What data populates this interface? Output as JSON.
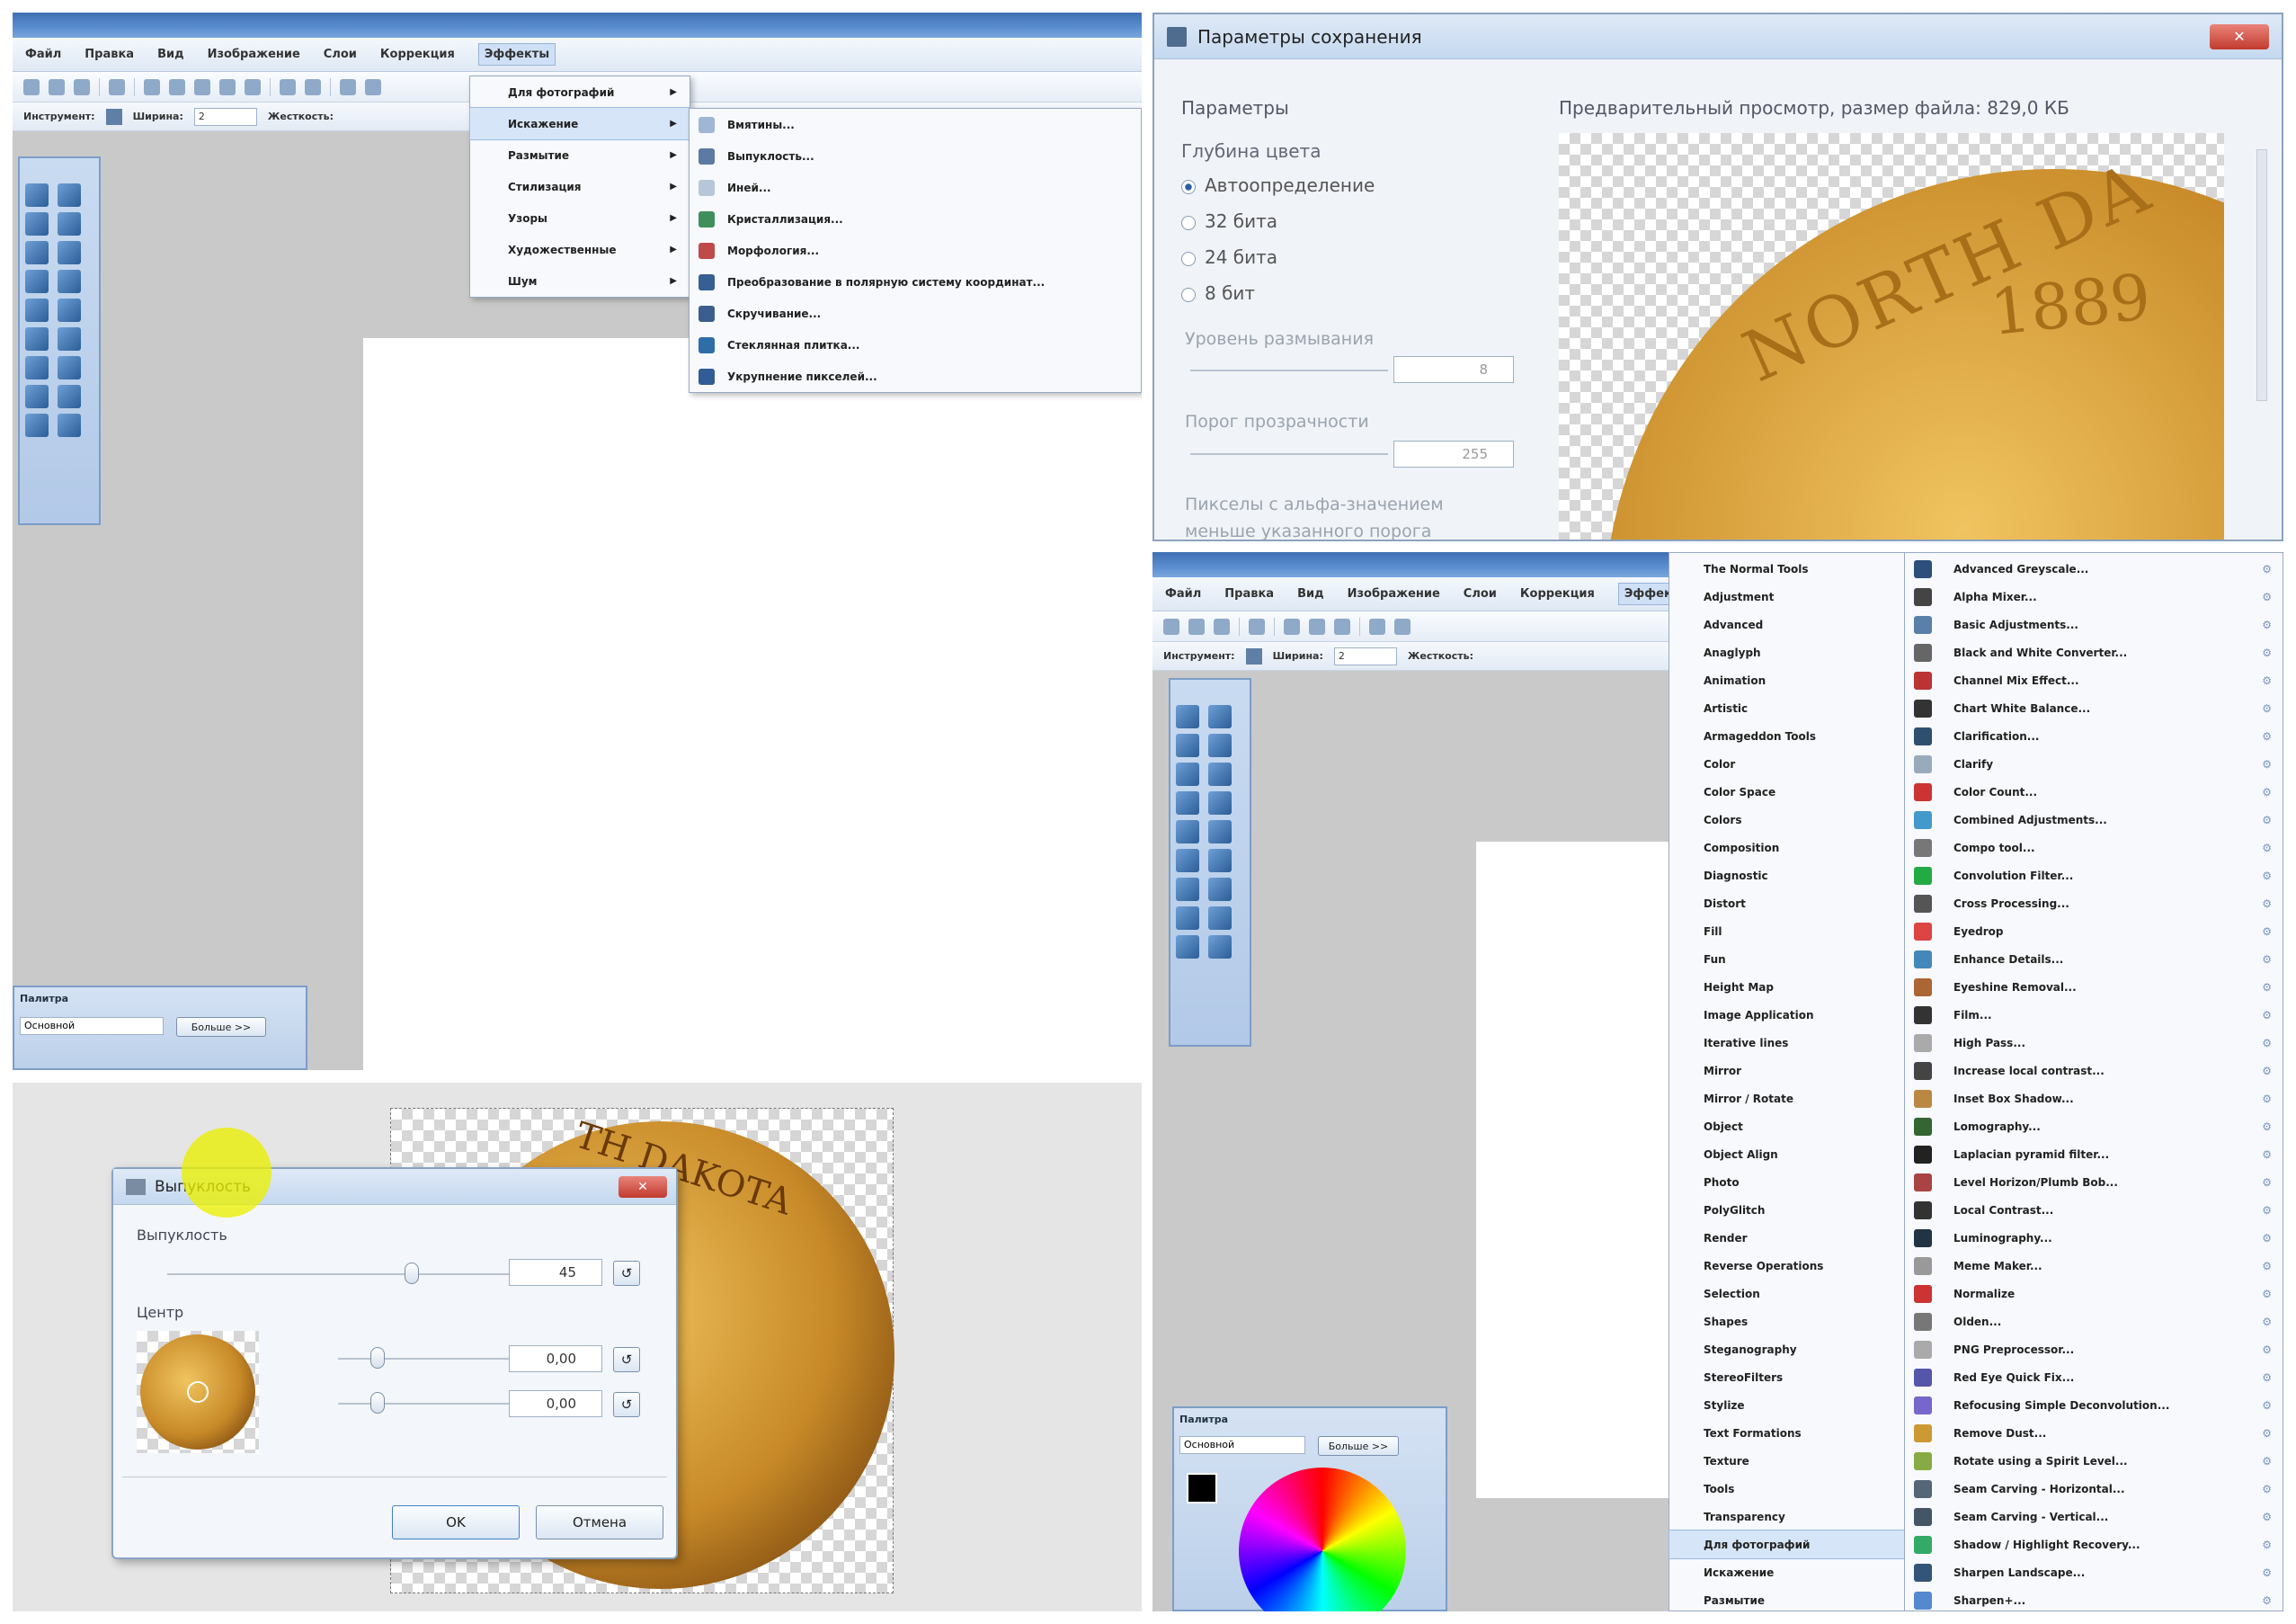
{
  "pdn_menu_panel": {
    "menubar": [
      "Файл",
      "Правка",
      "Вид",
      "Изображение",
      "Слои",
      "Коррекция",
      "Эффекты"
    ],
    "active_menu": "Эффекты",
    "tool_label": "Инструмент:",
    "width_label": "Ширина:",
    "width_value": "2",
    "hardness_label": "Жесткость:",
    "effects_menu": [
      {
        "label": "Для фотографий",
        "highlight": false
      },
      {
        "label": "Искажение",
        "highlight": true
      },
      {
        "label": "Размытие",
        "highlight": false
      },
      {
        "label": "Стилизация",
        "highlight": false
      },
      {
        "label": "Узоры",
        "highlight": false
      },
      {
        "label": "Художественные",
        "highlight": false
      },
      {
        "label": "Шум",
        "highlight": false
      }
    ],
    "distort_submenu": [
      "Вмятины...",
      "Выпуклость...",
      "Иней...",
      "Кристаллизация...",
      "Морфология...",
      "Преобразование в полярную систему координат...",
      "Скручивание...",
      "Стеклянная плитка...",
      "Укрупнение пикселей..."
    ],
    "palette": {
      "title": "Палитра",
      "mode": "Основной",
      "more_button": "Больше >>"
    }
  },
  "save_panel": {
    "title": "Параметры сохранения",
    "params_label": "Параметры",
    "preview_label": "Предварительный просмотр, размер файла: 829,0 КБ",
    "depth_label": "Глубина цвета",
    "depth_options": [
      {
        "label": "Автоопределение",
        "selected": true
      },
      {
        "label": "32 бита",
        "selected": false
      },
      {
        "label": "24 бита",
        "selected": false
      },
      {
        "label": "8 бит",
        "selected": false
      }
    ],
    "dither_label": "Уровень размывания",
    "dither_value": "8",
    "threshold_label": "Порог прозрачности",
    "threshold_value": "255",
    "alpha_text_1": "Пикселы с альфа-значением",
    "alpha_text_2": "меньше указанного порога",
    "coin_text_1": "NORTH DA",
    "coin_text_2": "1889"
  },
  "bulge_panel": {
    "title": "Выпуклость",
    "amount_label": "Выпуклость",
    "amount_value": "45",
    "center_label": "Центр",
    "center_x": "0,00",
    "center_y": "0,00",
    "ok_button": "OK",
    "cancel_button": "Отмена",
    "coin_text": "TH DAKOTA"
  },
  "plugins_panel": {
    "menubar": [
      "Файл",
      "Правка",
      "Вид",
      "Изображение",
      "Слои",
      "Коррекция",
      "Эффекты"
    ],
    "active_menu": "Эффекты",
    "tool_label": "Инструмент:",
    "width_label": "Ширина:",
    "width_value": "2",
    "hardness_label": "Жесткость:",
    "categories": [
      "The Normal Tools",
      "Adjustment",
      "Advanced",
      "Anaglyph",
      "Animation",
      "Artistic",
      "Armageddon Tools",
      "Color",
      "Color Space",
      "Colors",
      "Composition",
      "Diagnostic",
      "Distort",
      "Fill",
      "Fun",
      "Height Map",
      "Image Application",
      "Iterative lines",
      "Mirror",
      "Mirror / Rotate",
      "Object",
      "Object Align",
      "Photo",
      "PolyGlitch",
      "Render",
      "Reverse Operations",
      "Selection",
      "Shapes",
      "Steganography",
      "StereoFilters",
      "Stylize",
      "Text Formations",
      "Texture",
      "Tools",
      "Transparency",
      "Для фотографий",
      "Искажение",
      "Размытие"
    ],
    "highlight_category": "Для фотографий",
    "plugins": [
      "Advanced Greyscale...",
      "Alpha Mixer...",
      "Basic Adjustments...",
      "Black and White Converter...",
      "Channel Mix Effect...",
      "Chart White Balance...",
      "Clarification...",
      "Clarify",
      "Color Count...",
      "Combined Adjustments...",
      "Compo tool...",
      "Convolution Filter...",
      "Cross Processing...",
      "Eyedrop",
      "Enhance Details...",
      "Eyeshine Removal...",
      "Film...",
      "High Pass...",
      "Increase local contrast...",
      "Inset Box Shadow...",
      "Lomography...",
      "Laplacian pyramid filter...",
      "Level Horizon/Plumb Bob...",
      "Local Contrast...",
      "Luminography...",
      "Meme Maker...",
      "Normalize",
      "Olden...",
      "PNG Preprocessor...",
      "Red Eye Quick Fix...",
      "Refocusing Simple Deconvolution...",
      "Remove Dust...",
      "Rotate using a Spirit Level...",
      "Seam Carving - Horizontal...",
      "Seam Carving - Vertical...",
      "Shadow / Highlight Recovery...",
      "Sharpen Landscape...",
      "Sharpen+..."
    ],
    "palette": {
      "title": "Палитра",
      "mode": "Основной",
      "more_button": "Больше >>"
    }
  }
}
